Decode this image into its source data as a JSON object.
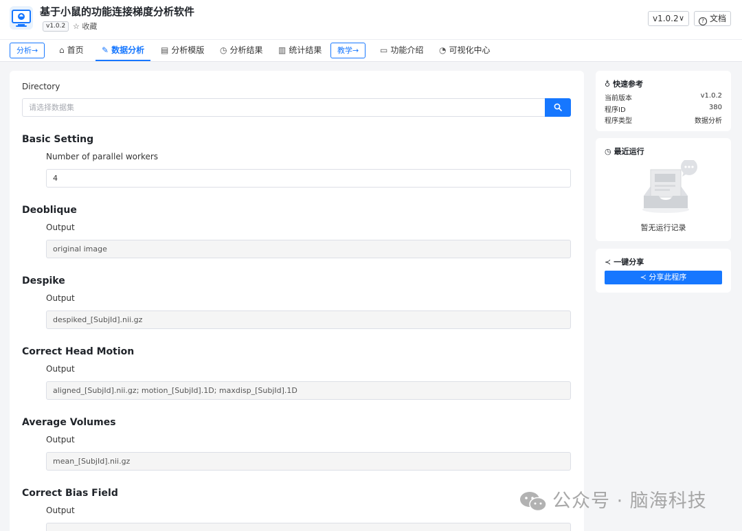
{
  "header": {
    "title": "基于小鼠的功能连接梯度分析软件",
    "version_badge": "v1.0.2",
    "favorite_label": "☆ 收藏",
    "version_select": "v1.0.2",
    "docs_label": "文档"
  },
  "nav": {
    "pill_analysis": "分析→",
    "home": "首页",
    "data_analysis": "数据分析",
    "analysis_template": "分析模版",
    "analysis_results": "分析结果",
    "stat_results": "统计结果",
    "pill_teaching": "教学→",
    "features": "功能介绍",
    "visualization": "可视化中心"
  },
  "main": {
    "directory_label": "Directory",
    "directory_placeholder": "请选择数据集",
    "sections": [
      {
        "title": "Basic Setting",
        "label": "Number of parallel workers",
        "value": "4"
      },
      {
        "title": "Deoblique",
        "label": "Output",
        "value": "original image"
      },
      {
        "title": "Despike",
        "label": "Output",
        "value": "despiked_[SubjId].nii.gz"
      },
      {
        "title": "Correct Head Motion",
        "label": "Output",
        "value": "aligned_[SubjId].nii.gz; motion_[SubjId].1D; maxdisp_[SubjId].1D"
      },
      {
        "title": "Average Volumes",
        "label": "Output",
        "value": "mean_[SubjId].nii.gz"
      },
      {
        "title": "Correct Bias Field",
        "label": "Output",
        "value": ""
      }
    ]
  },
  "sidebar": {
    "quick_ref": {
      "title": "快速参考",
      "rows": [
        {
          "k": "当前版本",
          "v": "v1.0.2"
        },
        {
          "k": "程序ID",
          "v": "380"
        },
        {
          "k": "程序类型",
          "v": "数据分析"
        }
      ]
    },
    "recent": {
      "title": "最近运行",
      "empty_text": "暂无运行记录"
    },
    "share": {
      "title": "一键分享",
      "button": "分享此程序"
    }
  },
  "watermark": {
    "text": "公众号 · 脑海科技"
  },
  "colors": {
    "primary": "#1677ff",
    "background": "#f4f5f7"
  }
}
